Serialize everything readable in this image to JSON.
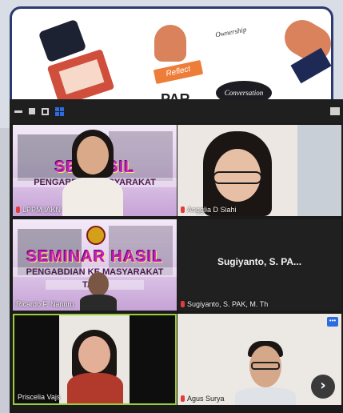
{
  "background": {
    "words": [
      "Ownership",
      "Reflect",
      "Conversation",
      "PAR"
    ]
  },
  "toolbar": {
    "icons": [
      "minimize-icon",
      "restore-icon",
      "menu-icon",
      "grid-view-icon",
      "screen-icon"
    ]
  },
  "tiles": [
    {
      "name": "LPPM IAKN",
      "slide_title": "SEMINAR HASIL",
      "slide_sub": "PENGABDIAN KEPADA MASYARAKAT",
      "visible_title": "SE   HASIL",
      "visible_sub": "PENGABDIA   AMASYARAKAT"
    },
    {
      "name": "Angglia D Siahi"
    },
    {
      "name": "Ricardo F. Nanuru",
      "slide_title": "SEMINAR HASIL",
      "slide_sub": "PENGABDIAN KE   MASYARAKAT",
      "slide_year": "TAH      2"
    },
    {
      "name": "Sugiyanto, S. PAK, M. Th",
      "display_label": "Sugiyanto, S. PA..."
    },
    {
      "name": "Priscelia Vajs"
    },
    {
      "name": "Agus Surya"
    }
  ],
  "colors": {
    "active_speaker_border": "#9ccc3a",
    "accent": "#2d6cdf",
    "slide_title": "#c71ec4"
  }
}
